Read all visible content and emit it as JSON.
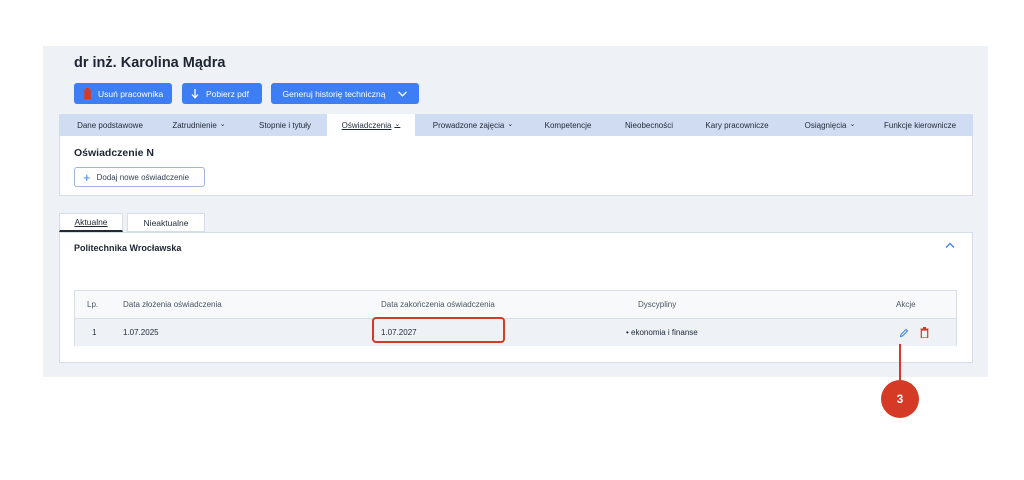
{
  "employee": {
    "name": "dr inż. Karolina Mądra"
  },
  "toolbar": {
    "delete_label": "Usuń pracownika",
    "pdf_label": "Pobierz pdf",
    "history_label": "Generuj historię techniczną"
  },
  "tabs": [
    {
      "label": "Dane podstawowe"
    },
    {
      "label": "Zatrudnienie"
    },
    {
      "label": "Stopnie i tytuły"
    },
    {
      "label": "Oświadczenia"
    },
    {
      "label": "Prowadzone zajęcia"
    },
    {
      "label": "Kompetencje"
    },
    {
      "label": "Nieobecności"
    },
    {
      "label": "Kary pracownicze"
    },
    {
      "label": "Osiągnięcia"
    },
    {
      "label": "Funkcje kierownicze"
    }
  ],
  "declaration": {
    "title": "Oświadczenie N",
    "add_label": "Dodaj nowe oświadczenie"
  },
  "subtabs": {
    "current": "Aktualne",
    "outdated": "Nieaktualne"
  },
  "organization": {
    "name": "Politechnika Wrocławska"
  },
  "table": {
    "headers": [
      "Lp.",
      "Data złożenia oświadczenia",
      "Data zakończenia oświadczenia",
      "Dyscypliny",
      "Akcje"
    ],
    "rows": [
      {
        "lp": "1",
        "submitted": "1.07.2025",
        "ended": "1.07.2027",
        "discipline": "• ekonomia i finanse"
      }
    ]
  },
  "callout": {
    "number": "3"
  },
  "colors": {
    "accent": "#3d7ef5",
    "highlight": "#d43a25",
    "tabbar": "#cfdcf1"
  }
}
